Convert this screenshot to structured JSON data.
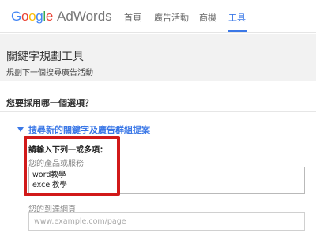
{
  "header": {
    "logo": {
      "brand_letters": [
        "G",
        "o",
        "o",
        "g",
        "l",
        "e"
      ],
      "brand_colors": [
        "#4285f4",
        "#ea4335",
        "#fbbc05",
        "#4285f4",
        "#34a853",
        "#ea4335"
      ],
      "product": "AdWords"
    },
    "nav": [
      {
        "label": "首頁",
        "active": false
      },
      {
        "label": "廣告活動",
        "active": false
      },
      {
        "label": "商機",
        "active": false
      },
      {
        "label": "工具",
        "active": true
      }
    ],
    "active_color": "#3b78e7"
  },
  "planner": {
    "title": "關鍵字規劃工具",
    "subtitle": "規劃下一個搜尋廣告活動"
  },
  "main": {
    "question": "您要採用哪一個選項？",
    "option": {
      "label": "搜尋新的關鍵字及廣告群組提案",
      "expanded": true
    },
    "form": {
      "required_label": "請輸入下列一或多項：",
      "product_field": {
        "label": "您的產品或服務",
        "lines": [
          "word教學",
          "excel教學"
        ]
      },
      "landing_field": {
        "label": "您的到達網頁",
        "value": "",
        "placeholder": "www.example.com/page"
      }
    },
    "highlight_color": "#d11919"
  }
}
